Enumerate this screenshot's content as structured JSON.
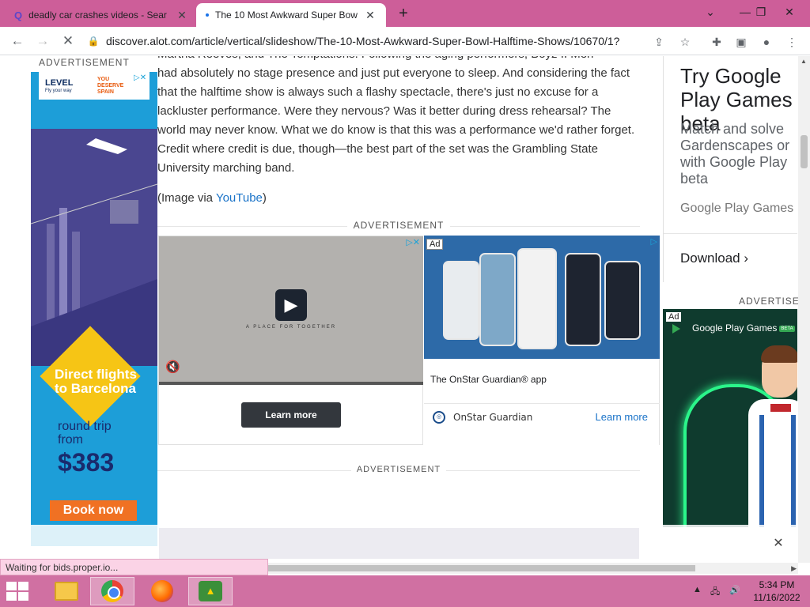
{
  "browser": {
    "tabs": [
      {
        "title": "deadly car crashes videos - Sear",
        "favicon": "search-favicon"
      },
      {
        "title": "The 10 Most Awkward Super Bow",
        "favicon": "loading-favicon"
      }
    ],
    "address": "discover.alot.com/article/vertical/slideshow/The-10-Most-Awkward-Super-Bowl-Halftime-Shows/10670/1?...",
    "status": "Waiting for bids.proper.io..."
  },
  "article": {
    "top_fragment": "Martha Reeves, and The Temptations. Following the aging performers, Boyz II Men",
    "paragraph": "had absolutely no stage presence and just put everyone to sleep. And considering the fact that the halftime show is always such a flashy spectacle, there's just no excuse for a lackluster performance. Were they nervous? Was it better during dress rehearsal? The world may never know. What we do know is that this was a performance we'd rather forget. Credit where credit is due, though—the best part of the set was the Grambling State University marching band.",
    "caption_prefix": "(Image via ",
    "caption_link": "YouTube",
    "caption_suffix": ")"
  },
  "ads": {
    "advertisement_label": "ADVERTISEMENT",
    "right_label": "ADVERTISE",
    "left_ad": {
      "brand": "LEVEL",
      "brand_sub": "Fly your way",
      "partner": "YOU DESERVE SPAIN",
      "headline": "Direct flights to Barcelona",
      "roundtrip": "round trip from",
      "price": "$383",
      "cta": "Book now"
    },
    "video_ad": {
      "brand_line": "A PLACE FOR TOGETHER",
      "cta": "Learn more"
    },
    "onstar_ad": {
      "tag": "Ad",
      "title": "The OnStar Guardian® app",
      "advertiser": "OnStar Guardian",
      "cta": "Learn more"
    },
    "right_card": {
      "title": "Try Google Play Games beta",
      "description": "Match and solve Gardenscapes or with Google Play beta",
      "source": "Google Play Games",
      "cta": "Download"
    },
    "gp_ad": {
      "tag": "Ad",
      "name": "Google Play Games",
      "badge": "BETA"
    }
  },
  "taskbar": {
    "time": "5:34 PM",
    "date": "11/16/2022",
    "apps": [
      "file-explorer",
      "chrome",
      "firefox",
      "game-app"
    ]
  },
  "colors": {
    "tabstrip": "#cd5e99",
    "taskbar": "#d070a2",
    "link": "#1a73c8"
  }
}
